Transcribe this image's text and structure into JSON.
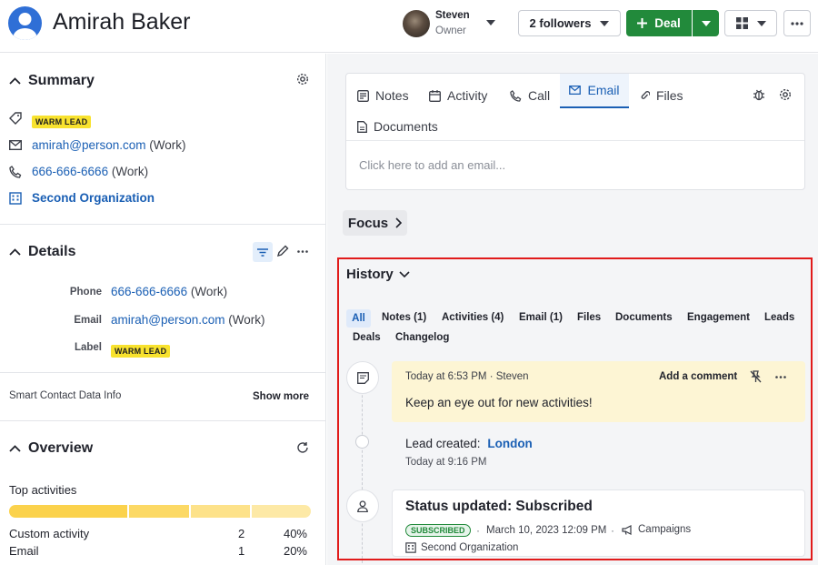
{
  "header": {
    "name": "Amirah Baker",
    "owner_name": "Steven",
    "owner_role": "Owner",
    "followers_label": "2 followers",
    "deal_label": "Deal"
  },
  "summary": {
    "title": "Summary",
    "label_badge": "WARM LEAD",
    "email": "amirah@person.com",
    "email_type": "(Work)",
    "phone": "666-666-6666",
    "phone_type": "(Work)",
    "organization": "Second Organization"
  },
  "details": {
    "title": "Details",
    "phone_label": "Phone",
    "phone": "666-666-6666",
    "phone_type": "(Work)",
    "email_label": "Email",
    "email": "amirah@person.com",
    "email_type": "(Work)",
    "label_label": "Label",
    "label_badge": "WARM LEAD"
  },
  "smart": {
    "text": "Smart Contact Data Info",
    "show_more": "Show more"
  },
  "overview": {
    "title": "Overview",
    "top_activities": "Top activities",
    "segments": [
      0.4,
      0.2,
      0.2,
      0.2
    ],
    "segment_colors": [
      "#fbd24c",
      "#fcd965",
      "#fde28a",
      "#fde9a6"
    ],
    "rows": [
      {
        "name": "Custom activity",
        "count": "2",
        "pct": "40%"
      },
      {
        "name": "Email",
        "count": "1",
        "pct": "20%"
      }
    ]
  },
  "composer": {
    "tabs": [
      "Notes",
      "Activity",
      "Call",
      "Email",
      "Files",
      "Documents"
    ],
    "active_tab": "Email",
    "placeholder": "Click here to add an email..."
  },
  "focus": {
    "label": "Focus"
  },
  "history": {
    "title": "History",
    "filters": [
      "All",
      "Notes (1)",
      "Activities (4)",
      "Email (1)",
      "Files",
      "Documents",
      "Engagement",
      "Leads",
      "Deals",
      "Changelog"
    ],
    "note": {
      "meta": "Today at 6:53 PM · Steven",
      "add_comment": "Add a comment",
      "text": "Keep an eye out for new activities!"
    },
    "lead": {
      "label": "Lead created:",
      "value": "London",
      "time": "Today at 9:16 PM"
    },
    "status": {
      "title": "Status updated: Subscribed",
      "badge": "SUBSCRIBED",
      "date": "March 10, 2023 12:09 PM",
      "campaigns": "Campaigns",
      "org": "Second Organization"
    }
  },
  "colors": {
    "accent_green": "#228a3b",
    "link_blue": "#1a5fb4",
    "highlight_red": "#e11b1b",
    "note_bg": "#fdf5d4"
  }
}
